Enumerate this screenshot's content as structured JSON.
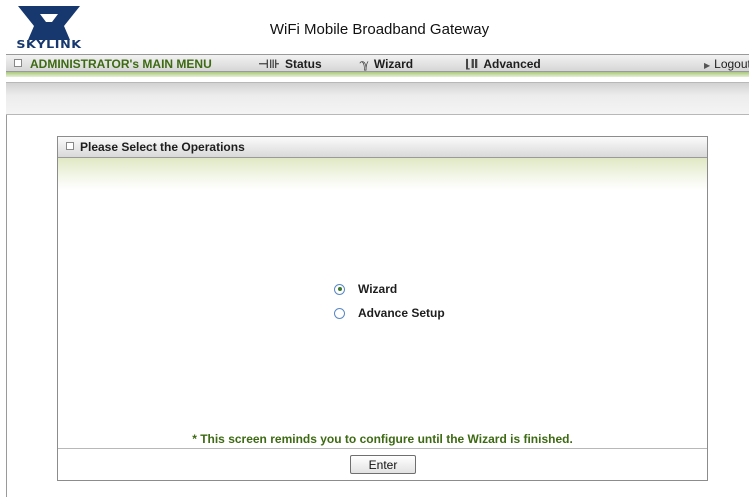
{
  "header": {
    "logo_text": "SKYLINK",
    "app_title": "WiFi Mobile Broadband Gateway"
  },
  "menu": {
    "admin_label": "ADMINISTRATOR's MAIN MENU",
    "status_label": "Status",
    "wizard_label": "Wizard",
    "advanced_label": "Advanced",
    "logout_label": "Logout"
  },
  "panel": {
    "title": "Please Select the Operations",
    "options": [
      {
        "label": "Wizard",
        "selected": true
      },
      {
        "label": "Advance Setup",
        "selected": false
      }
    ],
    "note": "* This screen reminds you to configure until the Wizard is finished.",
    "enter_label": "Enter"
  },
  "colors": {
    "brand_navy": "#16386e",
    "accent_green": "#3d6a12",
    "radio_border": "#5a88c6"
  }
}
